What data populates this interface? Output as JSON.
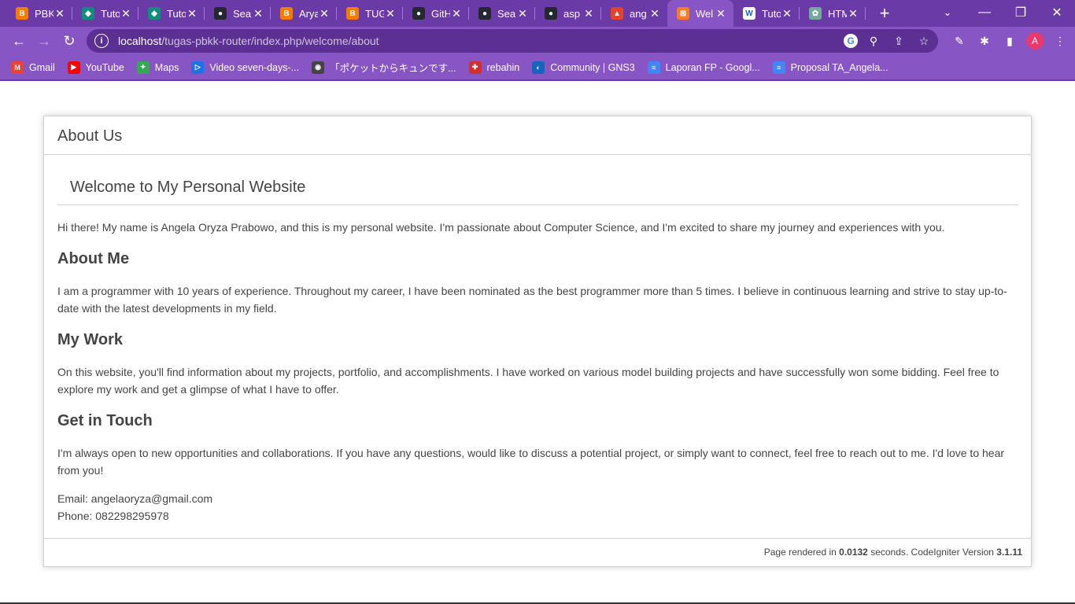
{
  "browser": {
    "tabs": [
      {
        "label": "PBK",
        "fav_color": "#f57c00",
        "fav_glyph": "B"
      },
      {
        "label": "Tuto",
        "fav_color": "#0f8f7a",
        "fav_glyph": "◆"
      },
      {
        "label": "Tuto",
        "fav_color": "#0f8f7a",
        "fav_glyph": "◆"
      },
      {
        "label": "Sea",
        "fav_color": "#24292f",
        "fav_glyph": "●"
      },
      {
        "label": "Arya",
        "fav_color": "#f57c00",
        "fav_glyph": "B"
      },
      {
        "label": "TUG",
        "fav_color": "#f57c00",
        "fav_glyph": "B"
      },
      {
        "label": "GitH",
        "fav_color": "#24292f",
        "fav_glyph": "●"
      },
      {
        "label": "Sea",
        "fav_color": "#24292f",
        "fav_glyph": "●"
      },
      {
        "label": "asp",
        "fav_color": "#24292f",
        "fav_glyph": "●"
      },
      {
        "label": "ang",
        "fav_color": "#e24329",
        "fav_glyph": "▲"
      },
      {
        "label": "Wel",
        "fav_color": "#fb7a24",
        "fav_glyph": "⊠",
        "active": true
      },
      {
        "label": "Tuto",
        "fav_color": "#ffffff",
        "fav_glyph": "W"
      },
      {
        "label": "HTM",
        "fav_color": "#74aa9c",
        "fav_glyph": "✿"
      }
    ],
    "url_host": "localhost",
    "url_path": "/tugas-pbkk-router/index.php/welcome/about",
    "bookmarks": [
      {
        "label": "Gmail",
        "fav_color": "#ea4335",
        "fav_glyph": "M"
      },
      {
        "label": "YouTube",
        "fav_color": "#ff0000",
        "fav_glyph": "▶"
      },
      {
        "label": "Maps",
        "fav_color": "#34a853",
        "fav_glyph": "✦"
      },
      {
        "label": "Video seven-days-...",
        "fav_color": "#1a73e8",
        "fav_glyph": "▷"
      },
      {
        "label": "「ポケットからキュンです...",
        "fav_color": "#444444",
        "fav_glyph": "◉"
      },
      {
        "label": "rebahin",
        "fav_color": "#d32f2f",
        "fav_glyph": "✚"
      },
      {
        "label": "Community | GNS3",
        "fav_color": "#1565c0",
        "fav_glyph": "◐"
      },
      {
        "label": "Laporan FP - Googl...",
        "fav_color": "#4285f4",
        "fav_glyph": "≡"
      },
      {
        "label": "Proposal TA_Angela...",
        "fav_color": "#4285f4",
        "fav_glyph": "≡"
      }
    ],
    "avatar_letter": "A"
  },
  "page": {
    "header_title": "About Us",
    "welcome_title": "Welcome to My Personal Website",
    "intro": "Hi there! My name is Angela Oryza Prabowo, and this is my personal website. I'm passionate about Computer Science, and I'm excited to share my journey and experiences with you.",
    "sections": [
      {
        "heading": "About Me",
        "text": "I am a programmer with 10 years of experience. Throughout my career, I have been nominated as the best programmer more than 5 times. I believe in continuous learning and strive to stay up-to-date with the latest developments in my field."
      },
      {
        "heading": "My Work",
        "text": "On this website, you'll find information about my projects, portfolio, and accomplishments. I have worked on various model building projects and have successfully won some bidding. Feel free to explore my work and get a glimpse of what I have to offer."
      },
      {
        "heading": "Get in Touch",
        "text": "I'm always open to new opportunities and collaborations. If you have any questions, would like to discuss a potential project, or simply want to connect, feel free to reach out to me. I'd love to hear from you!"
      }
    ],
    "email_line": "Email: angelaoryza@gmail.com",
    "phone_line": "Phone: 082298295978",
    "footer": {
      "prefix": "Page rendered in ",
      "time": "0.0132",
      "middle": " seconds. CodeIgniter Version ",
      "version": "3.1.11"
    }
  }
}
